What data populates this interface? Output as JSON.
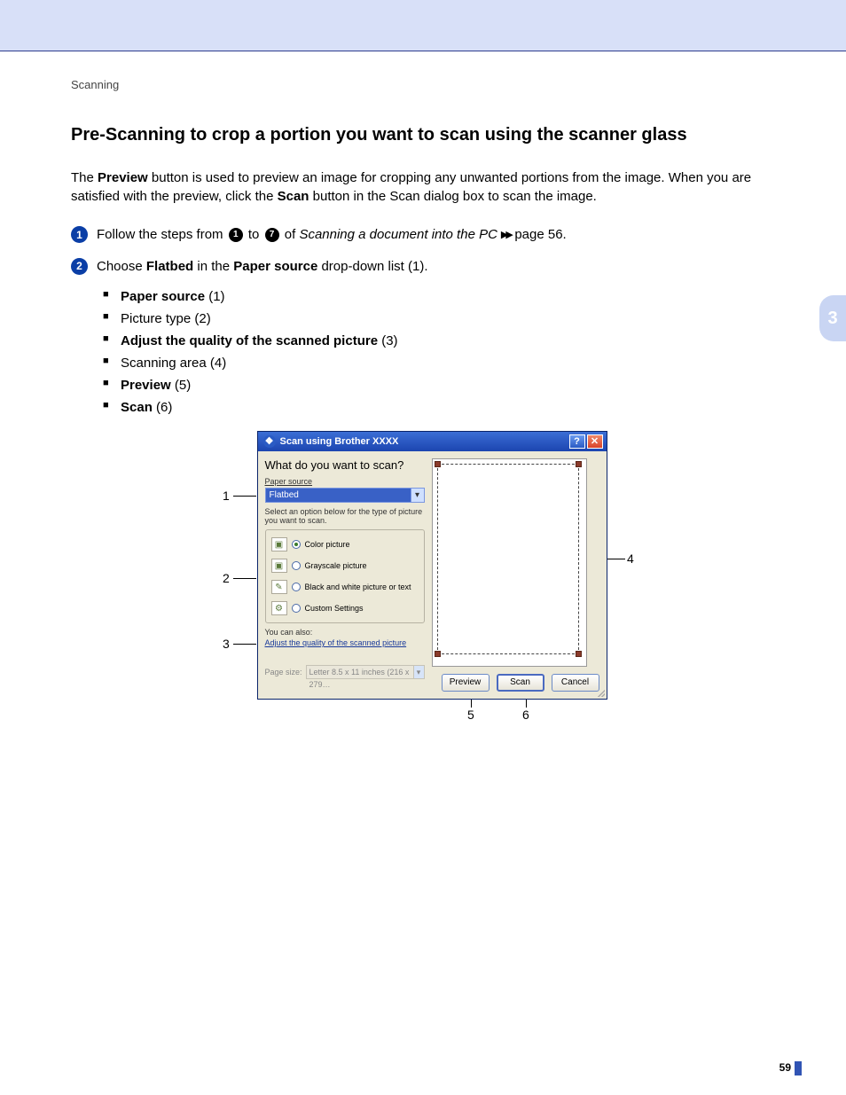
{
  "breadcrumb": "Scanning",
  "heading": "Pre-Scanning to crop a portion you want to scan using the scanner glass",
  "intro": {
    "p1a": "The ",
    "p1b": "Preview",
    "p1c": " button is used to preview an image for cropping any unwanted portions from the image. When you are satisfied with the preview, click the ",
    "p1d": "Scan",
    "p1e": " button in the Scan dialog box to scan the image."
  },
  "steps": {
    "s1": {
      "badge": "1",
      "a": "Follow the steps from ",
      "ref1": "1",
      "b": " to ",
      "ref2": "7",
      "c": " of ",
      "italic": "Scanning a document into the PC",
      "d": " page 56."
    },
    "s2": {
      "badge": "2",
      "a": "Choose ",
      "bold1": "Flatbed",
      "b": " in the ",
      "bold2": "Paper source",
      "c": " drop-down list (1)."
    }
  },
  "bullets": [
    {
      "bold": "Paper source",
      "plain": " (1)"
    },
    {
      "bold": "",
      "plain": "Picture type (2)"
    },
    {
      "bold": "Adjust the quality of the scanned picture",
      "plain": " (3)"
    },
    {
      "bold": "",
      "plain": "Scanning area (4)"
    },
    {
      "bold": "Preview",
      "plain": " (5)"
    },
    {
      "bold": "Scan",
      "plain": " (6)"
    }
  ],
  "side_tab": "3",
  "dialog": {
    "title": "Scan using Brother  XXXX",
    "heading": "What do you want to scan?",
    "paper_source_label": "Paper source",
    "paper_source_value": "Flatbed",
    "option_hint": "Select an option below for the type of picture you want to scan.",
    "radios": {
      "color": "Color picture",
      "gray": "Grayscale picture",
      "bw": "Black and white picture or text",
      "custom": "Custom Settings"
    },
    "you_can_also": "You can also:",
    "adjust_link": "Adjust the quality of the scanned picture",
    "page_size_label": "Page size:",
    "page_size_value": "Letter 8.5 x 11 inches (216 x 279…",
    "buttons": {
      "preview": "Preview",
      "scan": "Scan",
      "cancel": "Cancel"
    }
  },
  "callouts": {
    "c1": "1",
    "c2": "2",
    "c3": "3",
    "c4": "4",
    "c5": "5",
    "c6": "6"
  },
  "page_number": "59"
}
